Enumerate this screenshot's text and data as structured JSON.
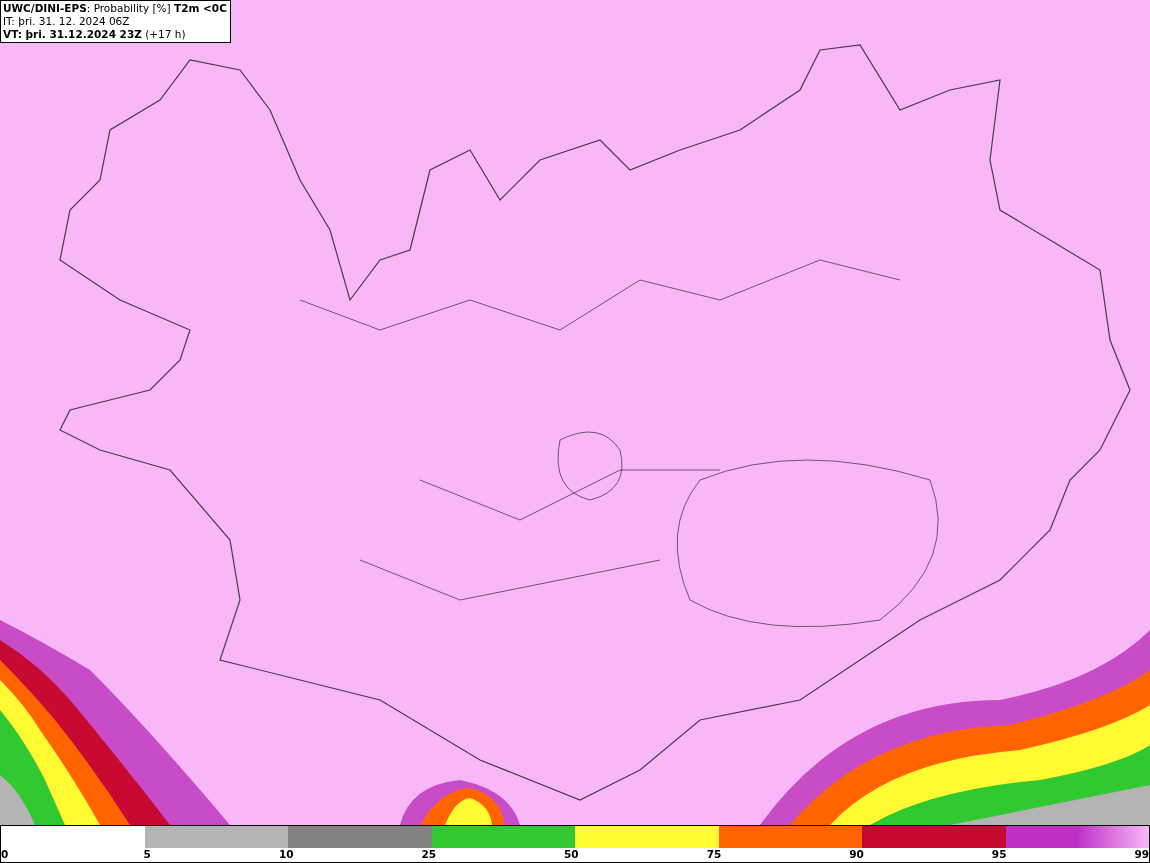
{
  "header": {
    "title": "**UWC/DINI-EPS**: Probability [%] **T2m <0C**",
    "initial_time": "IT: þri. 31. 12. 2024 06Z",
    "valid_time": "**VT: þri. 31.12.2024 23Z** (+17 h)"
  },
  "legend": {
    "start_label": "0",
    "segments": [
      {
        "label": "5"
      },
      {
        "color": "#b4b4b4",
        "label": "10"
      },
      {
        "color": "#828282",
        "label": "25"
      },
      {
        "color": "#32c832",
        "label": "50"
      },
      {
        "color": "#fffa32",
        "label": "75"
      },
      {
        "color": "#ff6400",
        "label": "90"
      },
      {
        "color": "#c80a32",
        "label": "95"
      },
      {
        "color": "#c030c8",
        "kind": "gradient",
        "label": "99"
      }
    ]
  }
}
